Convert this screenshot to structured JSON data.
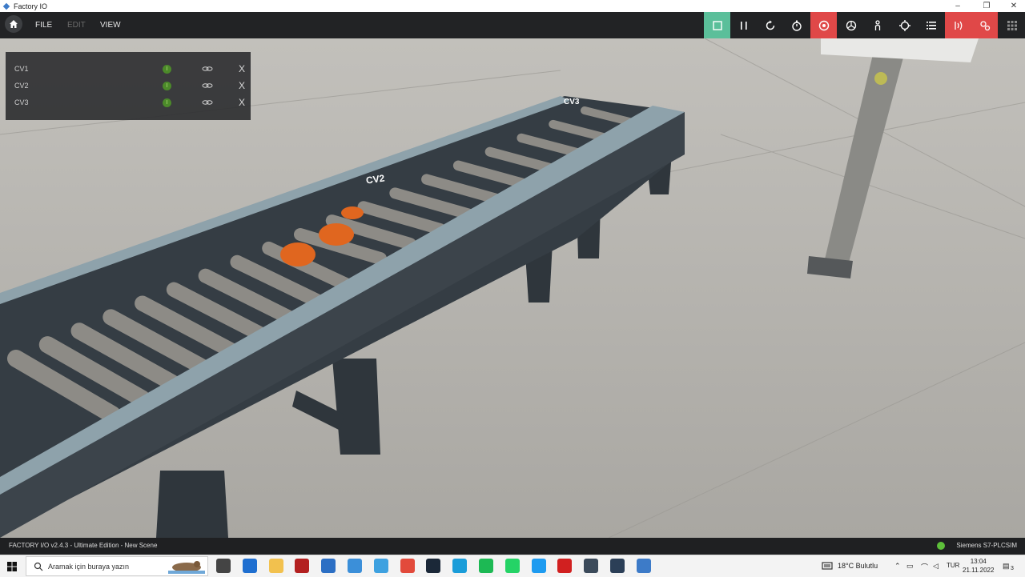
{
  "window": {
    "title": "Factory IO",
    "controls": {
      "minimize": "–",
      "maximize": "❐",
      "close": "✕"
    }
  },
  "menu": {
    "file": "FILE",
    "edit": "EDIT",
    "view": "VIEW"
  },
  "toolbar": {
    "colors": {
      "active": "#5bbf9a",
      "alert": "#e04848",
      "default": "#222325"
    },
    "buttons": [
      {
        "icon": "stop-icon",
        "state": "active"
      },
      {
        "icon": "pause-icon",
        "state": "default"
      },
      {
        "icon": "reset-icon",
        "state": "default"
      },
      {
        "icon": "timer-icon",
        "state": "default"
      },
      {
        "icon": "camera-orbit-icon",
        "state": "alert"
      },
      {
        "icon": "camera-fly-icon",
        "state": "default"
      },
      {
        "icon": "camera-first-person-icon",
        "state": "default"
      },
      {
        "icon": "crosshair-icon",
        "state": "default"
      },
      {
        "icon": "list-icon",
        "state": "default"
      },
      {
        "icon": "sensors-icon",
        "state": "alert"
      },
      {
        "icon": "drivers-icon",
        "state": "alert"
      },
      {
        "icon": "grid-icon",
        "state": "default"
      }
    ]
  },
  "io_panel": {
    "rows": [
      {
        "name": "CV1",
        "value": "I",
        "close": "X"
      },
      {
        "name": "CV2",
        "value": "I",
        "close": "X"
      },
      {
        "name": "CV3",
        "value": "I",
        "close": "X"
      }
    ]
  },
  "scene": {
    "labels": {
      "cv2": "CV2",
      "cv3": "CV3"
    },
    "colors": {
      "floor": "#b3b1ac",
      "frame": "#3c444b",
      "rail": "#8ea2ab",
      "roller": "#8d8b86",
      "motor": "#e0661f"
    }
  },
  "status": {
    "version": "FACTORY I/O v2.4.3 - Ultimate Edition - New Scene",
    "driver": "Siemens S7-PLCSIM"
  },
  "taskbar": {
    "search_placeholder": "Aramak için buraya yazın",
    "weather": "18°C  Bulutlu",
    "language": "TUR",
    "time": "13:04",
    "date": "21.11.2022",
    "notifications": "3",
    "apps": [
      {
        "icon": "task-view-icon",
        "color": "#444444"
      },
      {
        "icon": "store-icon",
        "color": "#1f6fd0"
      },
      {
        "icon": "file-explorer-icon",
        "color": "#f2c14e"
      },
      {
        "icon": "app-red-icon",
        "color": "#b32020"
      },
      {
        "icon": "mail-icon",
        "color": "#2c6fc4"
      },
      {
        "icon": "app-blue-icon",
        "color": "#3b8fd9"
      },
      {
        "icon": "ie-icon",
        "color": "#3ea1e0"
      },
      {
        "icon": "chrome-icon",
        "color": "#e24a3b"
      },
      {
        "icon": "steam-icon",
        "color": "#1b2838"
      },
      {
        "icon": "edge-icon",
        "color": "#1a9dd9"
      },
      {
        "icon": "spotify-icon",
        "color": "#1db954"
      },
      {
        "icon": "whatsapp-icon",
        "color": "#25d366"
      },
      {
        "icon": "app-twitter-icon",
        "color": "#1d9bf0"
      },
      {
        "icon": "record-icon",
        "color": "#d12020"
      },
      {
        "icon": "tia-portal-icon",
        "color": "#3b4a5a"
      },
      {
        "icon": "plcsim-icon",
        "color": "#2b3f57"
      },
      {
        "icon": "factoryio-icon",
        "color": "#3d7bc8"
      }
    ]
  }
}
